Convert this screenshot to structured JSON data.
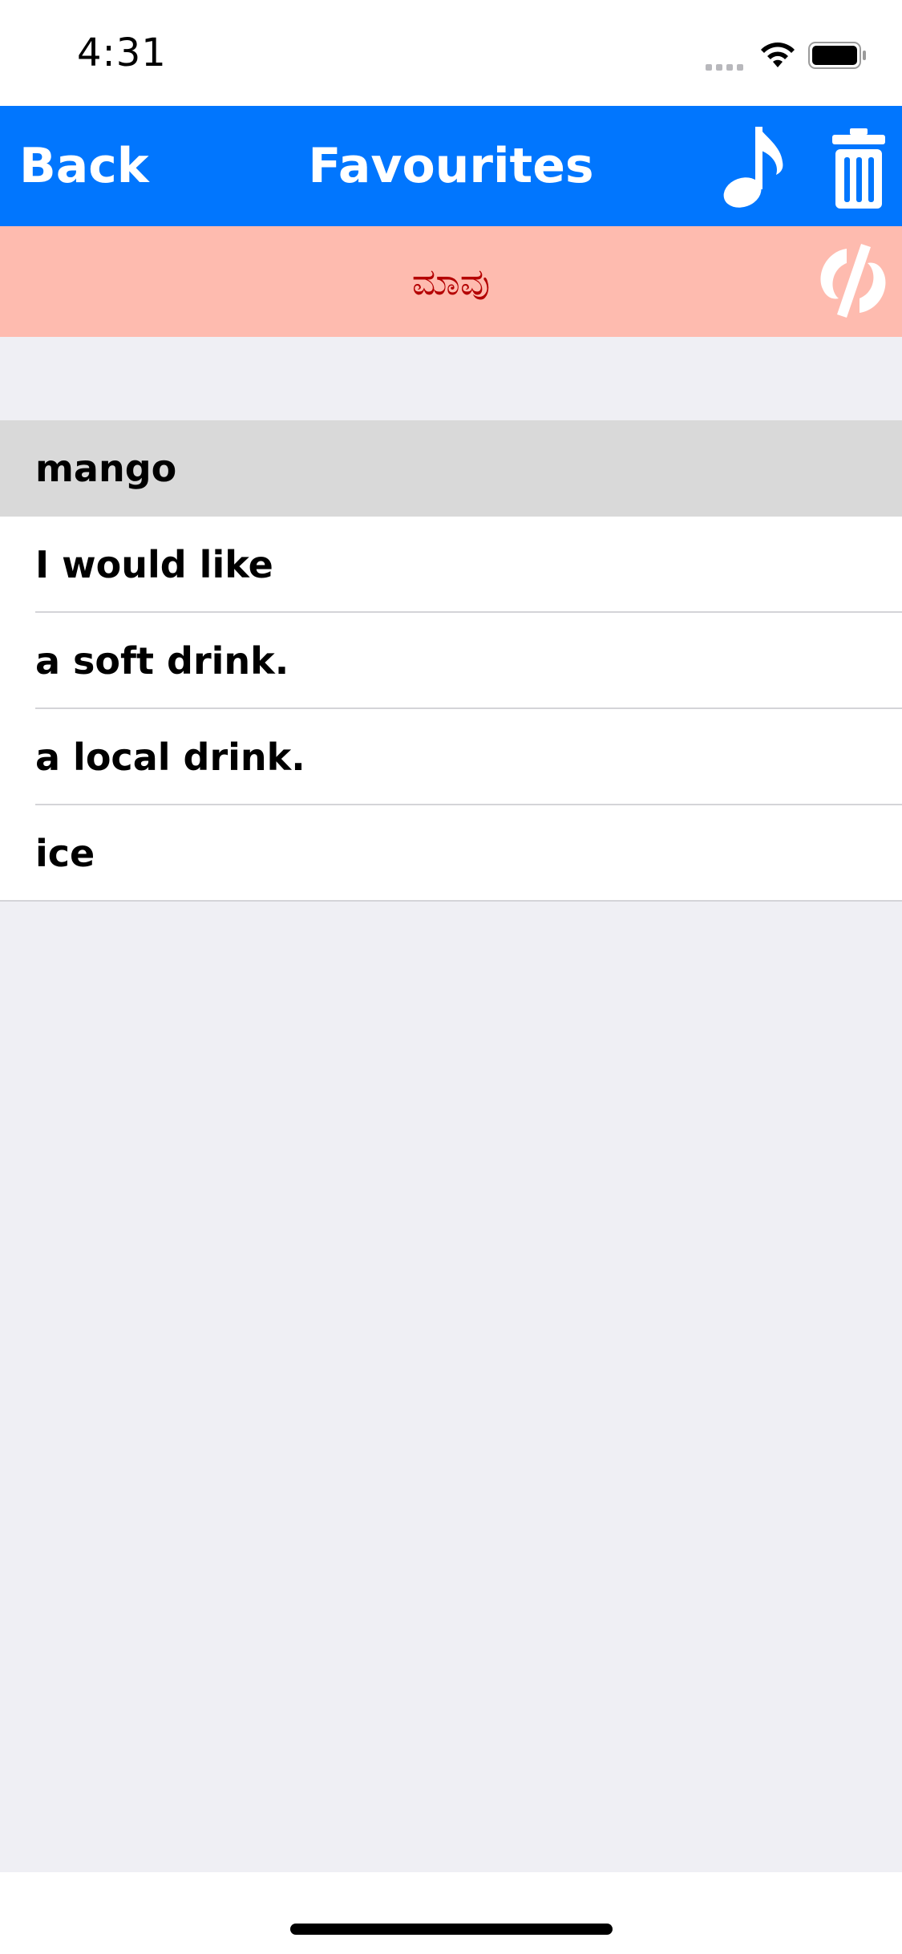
{
  "status_bar": {
    "time": "4:31"
  },
  "nav": {
    "back_label": "Back",
    "title": "Favourites",
    "music_icon": "music-note-icon",
    "trash_icon": "trash-icon"
  },
  "banner": {
    "phrase": "ಮಾವು",
    "flip_icon": "flip-icon"
  },
  "list": {
    "items": [
      {
        "label": "mango",
        "selected": true
      },
      {
        "label": "I would like"
      },
      {
        "label": "a soft drink."
      },
      {
        "label": "a local drink."
      },
      {
        "label": "ice"
      }
    ]
  },
  "colors": {
    "nav_bar": "#0176fe",
    "banner": "#febbaf",
    "banner_text": "#b40000",
    "selected_row": "#d9d9d9",
    "background": "#efeff4"
  }
}
